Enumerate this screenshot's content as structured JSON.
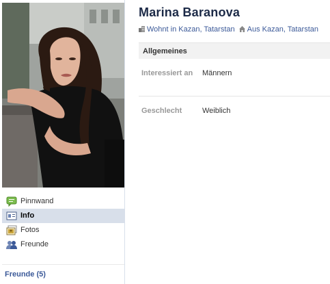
{
  "profile": {
    "name": "Marina Baranova",
    "lives_in": "Wohnt in Kazan, Tatarstan",
    "from": "Aus Kazan, Tatarstan"
  },
  "left_nav": {
    "items": [
      {
        "label": "Pinnwand",
        "icon": "wall-speech-bubble-icon"
      },
      {
        "label": "Info",
        "icon": "info-card-icon",
        "selected": true
      },
      {
        "label": "Fotos",
        "icon": "photos-icon"
      },
      {
        "label": "Freunde",
        "icon": "friends-icon"
      }
    ]
  },
  "friends_box": {
    "title": "Freunde (5)"
  },
  "info_section": {
    "title": "Allgemeines",
    "rows": [
      {
        "label": "Interessiert an",
        "value": "Männern"
      },
      {
        "label": "Geschlecht",
        "value": "Weiblich"
      }
    ]
  },
  "colors": {
    "brand_blue": "#3b5998",
    "name_navy": "#1c2a47",
    "selected_nav_bg": "#d8dfea",
    "section_bg": "#f2f2f2",
    "label_gray": "#999999"
  }
}
